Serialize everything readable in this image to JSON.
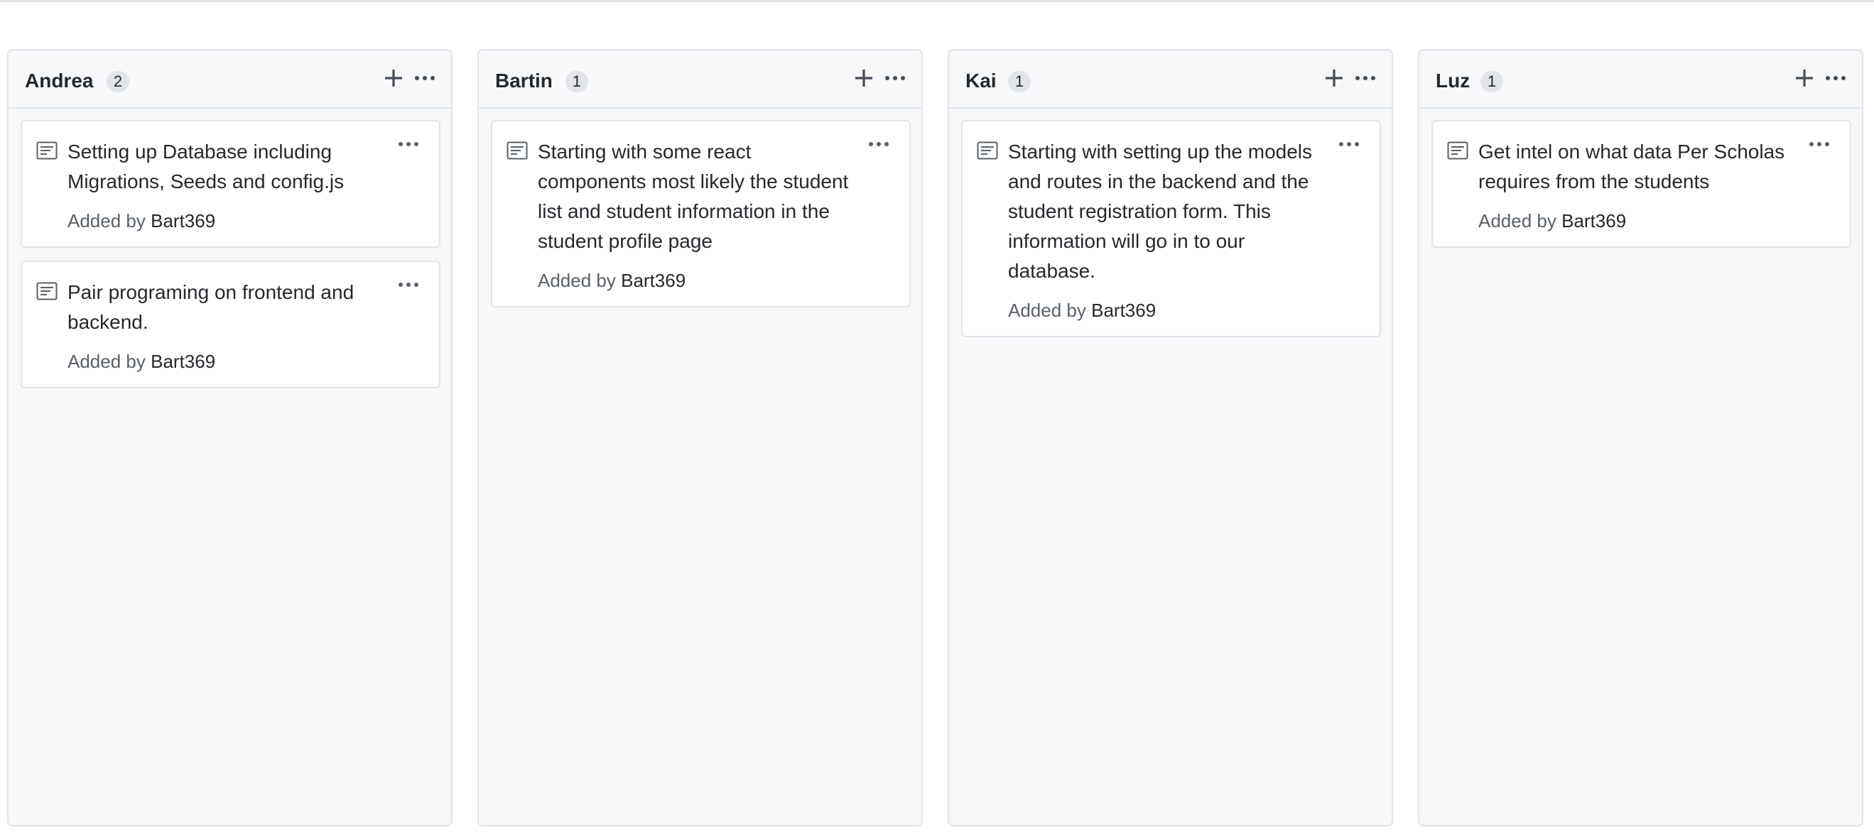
{
  "board": {
    "columns": [
      {
        "name": "Andrea",
        "count": "2",
        "cards": [
          {
            "note": "Setting up Database including Migrations, Seeds and config.js",
            "added_by_label": "Added by",
            "author": "Bart369"
          },
          {
            "note": "Pair programing on frontend and backend.",
            "added_by_label": "Added by",
            "author": "Bart369"
          }
        ]
      },
      {
        "name": "Bartin",
        "count": "1",
        "cards": [
          {
            "note": "Starting with some react components most likely the student list and student information in the student profile page",
            "added_by_label": "Added by",
            "author": "Bart369"
          }
        ]
      },
      {
        "name": "Kai",
        "count": "1",
        "cards": [
          {
            "note": "Starting with setting up the models and routes in the backend and the student registration form. This information will go in to our database.",
            "added_by_label": "Added by",
            "author": "Bart369"
          }
        ]
      },
      {
        "name": "Luz",
        "count": "1",
        "cards": [
          {
            "note": "Get intel on what data Per Scholas requires from the students",
            "added_by_label": "Added by",
            "author": "Bart369"
          }
        ]
      }
    ],
    "icons": {
      "add": "plus-icon",
      "column_menu": "kebab-horizontal-icon",
      "card_menu": "kebab-horizontal-icon",
      "card_type": "note-icon"
    },
    "colors": {
      "column_bg": "#f6f8fa",
      "border": "#e1e4e8",
      "text": "#24292e",
      "muted": "#586069",
      "counter_bg": "#e1e4e8"
    }
  }
}
